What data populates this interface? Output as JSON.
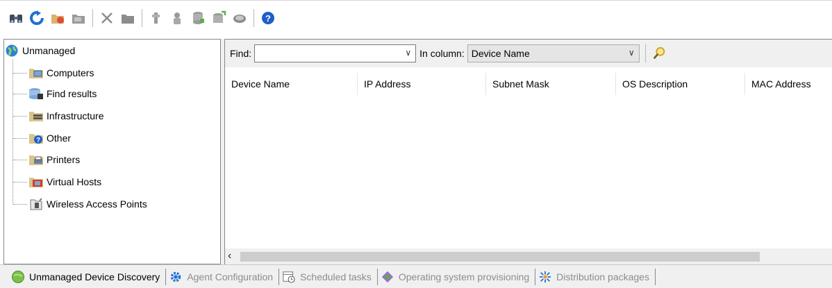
{
  "toolbar": {
    "buttons": [
      {
        "icon": "binoculars-icon"
      },
      {
        "icon": "refresh-icon"
      },
      {
        "icon": "folder-new-icon"
      },
      {
        "icon": "folder-move-icon"
      },
      {
        "icon": "delete-icon"
      },
      {
        "icon": "folder-icon"
      },
      {
        "icon": "agent-push-icon"
      },
      {
        "icon": "agent-icon"
      },
      {
        "icon": "database-icon"
      },
      {
        "icon": "database-add-icon"
      },
      {
        "icon": "disk-icon"
      },
      {
        "icon": "help-icon"
      }
    ]
  },
  "tree": {
    "root": "Unmanaged",
    "items": [
      {
        "label": "Computers",
        "icon": "computers-folder-icon"
      },
      {
        "label": "Find results",
        "icon": "find-results-icon"
      },
      {
        "label": "Infrastructure",
        "icon": "infrastructure-icon"
      },
      {
        "label": "Other",
        "icon": "other-folder-icon"
      },
      {
        "label": "Printers",
        "icon": "printers-folder-icon"
      },
      {
        "label": "Virtual Hosts",
        "icon": "virtual-hosts-icon"
      },
      {
        "label": "Wireless Access Points",
        "icon": "wireless-ap-icon"
      }
    ]
  },
  "findbar": {
    "find_label": "Find:",
    "find_value": "",
    "column_label": "In column:",
    "column_value": "Device Name"
  },
  "grid": {
    "columns": [
      "Device Name",
      "IP Address",
      "Subnet Mask",
      "OS Description",
      "MAC Address"
    ],
    "rows": []
  },
  "tabs": [
    {
      "label": "Unmanaged Device Discovery",
      "icon": "discovery-globe-icon",
      "active": true
    },
    {
      "label": "Agent Configuration",
      "icon": "gear-icon",
      "active": false
    },
    {
      "label": "Scheduled tasks",
      "icon": "calendar-clock-icon",
      "active": false
    },
    {
      "label": "Operating system provisioning",
      "icon": "os-provisioning-icon",
      "active": false
    },
    {
      "label": "Distribution packages",
      "icon": "distribution-packages-icon",
      "active": false
    }
  ],
  "colors": {
    "accent": "#1e6fd8",
    "panel_bg": "#f0f0f0",
    "border": "#828790",
    "inactive_text": "#8c8c8c"
  }
}
